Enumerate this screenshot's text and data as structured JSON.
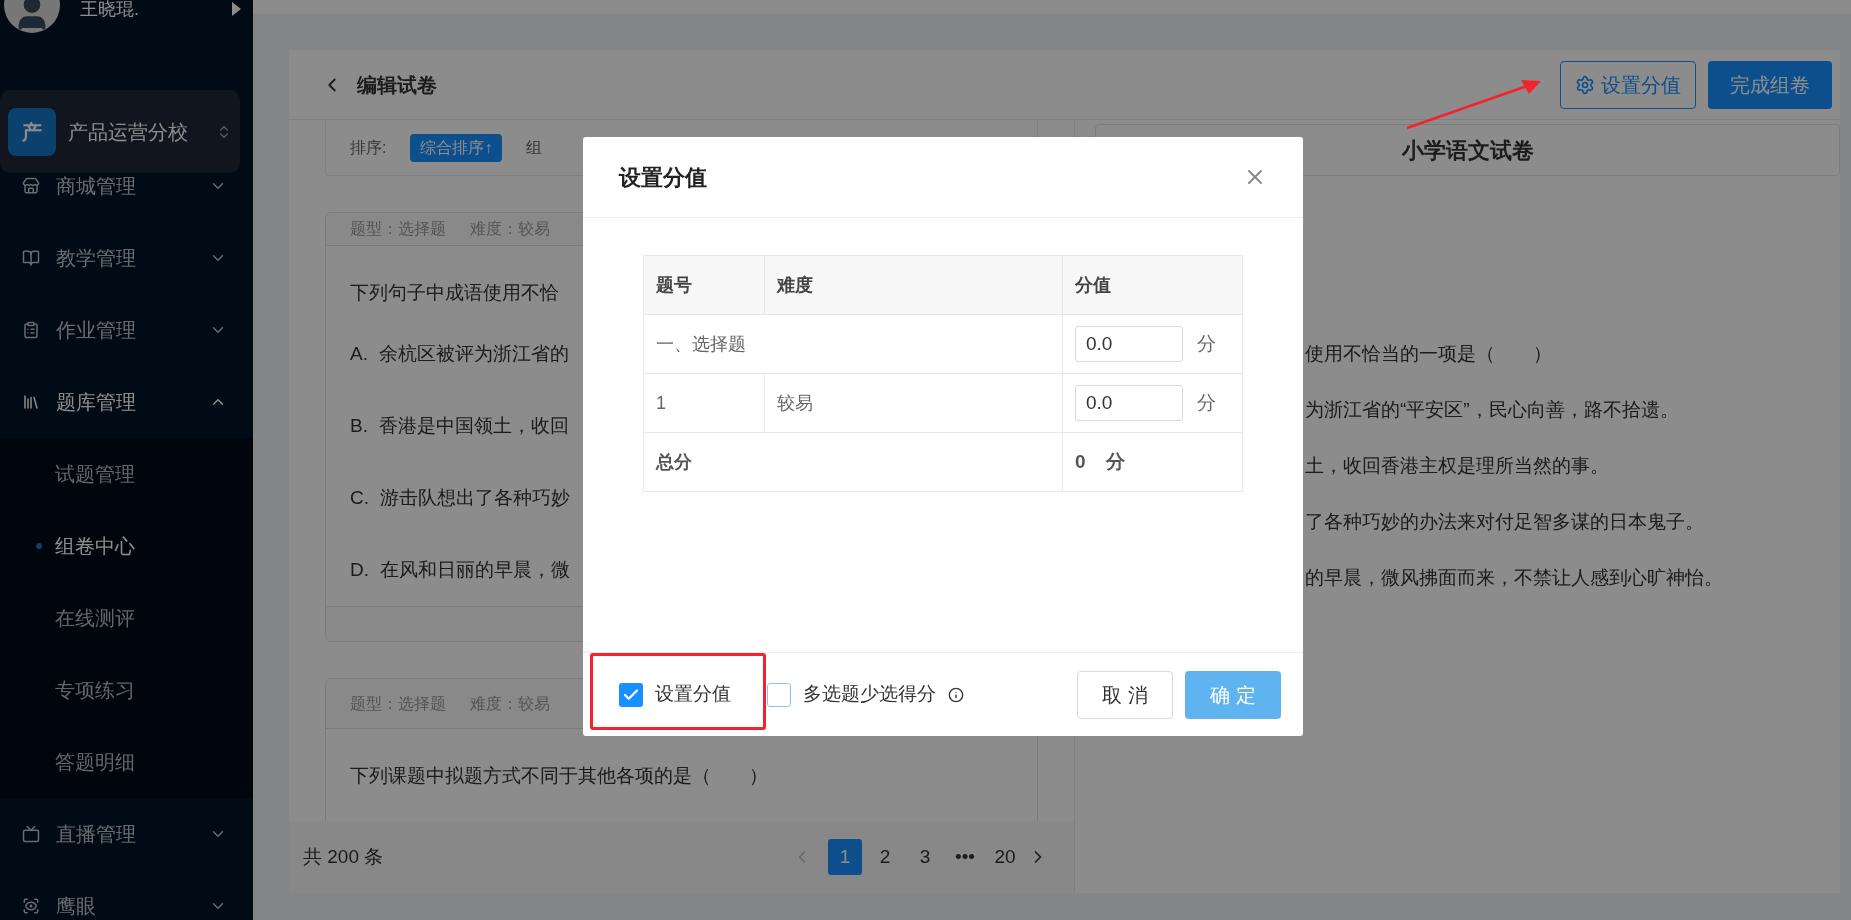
{
  "sidebar": {
    "user": {
      "name": "王晓琨."
    },
    "school": {
      "badge": "产",
      "name": "产品运营分校"
    },
    "items": [
      {
        "label": "商城管理",
        "expanded": false
      },
      {
        "label": "教学管理",
        "expanded": false
      },
      {
        "label": "作业管理",
        "expanded": false
      },
      {
        "label": "题库管理",
        "expanded": true,
        "children": [
          {
            "label": "试题管理",
            "selected": false
          },
          {
            "label": "组卷中心",
            "selected": true
          },
          {
            "label": "在线测评",
            "selected": false
          },
          {
            "label": "专项练习",
            "selected": false
          },
          {
            "label": "答题明细",
            "selected": false
          }
        ]
      },
      {
        "label": "直播管理",
        "expanded": false
      },
      {
        "label": "鹰眼",
        "expanded": false
      }
    ]
  },
  "page": {
    "title": "编辑试卷",
    "actions": [
      {
        "label": "设置分值",
        "kind": "outline"
      },
      {
        "label": "完成组卷",
        "kind": "primary"
      }
    ]
  },
  "sort": {
    "label": "排序:",
    "options": [
      {
        "label": "综合排序↑",
        "selected": true
      },
      {
        "label": "组",
        "selected": false
      }
    ]
  },
  "questions": [
    {
      "meta": [
        "题型：选择题",
        "难度：较易"
      ],
      "stem": "下列句子中成语使用不恰",
      "options": [
        "A.  余杭区被评为浙江省的",
        "B.  香港是中国领土，收回",
        "C.  游击队想出了各种巧妙",
        "D.  在风和日丽的早晨，微"
      ]
    },
    {
      "meta": [
        "题型：选择题",
        "难度：较易"
      ],
      "stem": "下列课题中拟题方式不同于其他各项的是（　　）"
    }
  ],
  "pagination": {
    "total": "共 200 条",
    "pages": [
      {
        "label": "1",
        "selected": true
      },
      {
        "label": "2",
        "selected": false
      },
      {
        "label": "3",
        "selected": false
      },
      {
        "label": "•••",
        "selected": false
      },
      {
        "label": "20",
        "selected": false
      }
    ]
  },
  "preview": {
    "title": "小学语文试卷",
    "lines": [
      "使用不恰当的一项是（　　）",
      "为浙江省的“平安区”，民心向善，路不拾遗。",
      "土，收回香港主权是理所当然的事。",
      "了各种巧妙的办法来对付足智多谋的日本鬼子。",
      "的早晨，微风拂面而来，不禁让人感到心旷神怡。"
    ]
  },
  "modal": {
    "title": "设置分值",
    "table": {
      "columns": [
        "题号",
        "难度",
        "分值"
      ],
      "rows": [
        {
          "kind": "section",
          "label": "一、选择题",
          "value": "0.0",
          "unit": "分"
        },
        {
          "kind": "question",
          "number": "1",
          "difficulty": "较易",
          "value": "0.0",
          "unit": "分"
        },
        {
          "kind": "total",
          "label": "总分",
          "value": "0",
          "suffix": "分"
        }
      ]
    },
    "checkboxes": [
      {
        "label": "设置分值",
        "checked": true,
        "hint": false
      },
      {
        "label": "多选题少选得分",
        "checked": false,
        "hint": true
      }
    ],
    "buttons": [
      {
        "label": "取 消",
        "kind": "default"
      },
      {
        "label": "确 定",
        "kind": "primary"
      }
    ]
  }
}
